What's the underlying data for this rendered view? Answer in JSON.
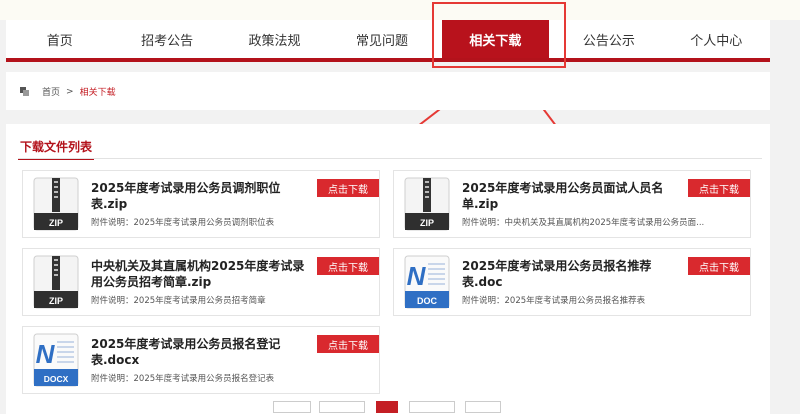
{
  "nav": {
    "items": [
      {
        "label": "首页"
      },
      {
        "label": "招考公告"
      },
      {
        "label": "政策法规"
      },
      {
        "label": "常见问题"
      },
      {
        "label": "相关下载"
      },
      {
        "label": "公告公示"
      },
      {
        "label": "个人中心"
      }
    ],
    "active_index": 4
  },
  "breadcrumb": {
    "home": "首页",
    "separator": ">",
    "current": "相关下载"
  },
  "list": {
    "title": "下载文件列表",
    "download_label": "点击下载",
    "files": [
      {
        "title": "2025年度考试录用公务员调剂职位表.zip",
        "desc": "附件说明：2025年度考试录用公务员调剂职位表",
        "type": "ZIP"
      },
      {
        "title": "2025年度考试录用公务员面试人员名单.zip",
        "desc": "附件说明：中央机关及其直属机构2025年度考试录用公务员面...",
        "type": "ZIP"
      },
      {
        "title": "中央机关及其直属机构2025年度考试录用公务员招考简章.zip",
        "desc": "附件说明：2025年度考试录用公务员招考简章",
        "type": "ZIP"
      },
      {
        "title": "2025年度考试录用公务员报名推荐表.doc",
        "desc": "附件说明：2025年度考试录用公务员报名推荐表",
        "type": "DOC"
      },
      {
        "title": "2025年度考试录用公务员报名登记表.docx",
        "desc": "附件说明：2025年度考试录用公务员报名登记表",
        "type": "DOCX"
      }
    ]
  },
  "colors": {
    "brand_red": "#b8121c",
    "button_red": "#d9292e",
    "annotation_red": "#e53935"
  },
  "icons": {
    "zip": "zip-file-icon",
    "doc": "word-file-icon"
  }
}
